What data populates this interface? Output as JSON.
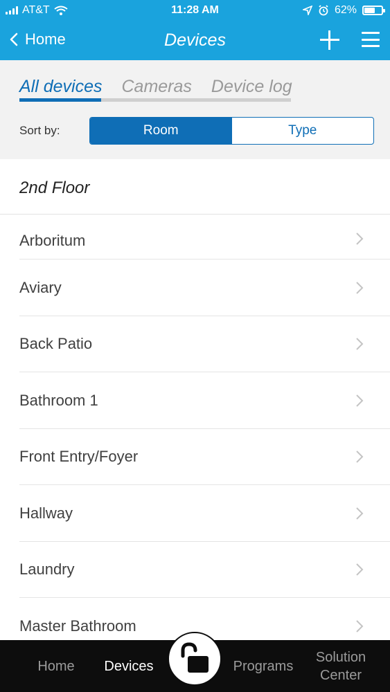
{
  "status": {
    "carrier": "AT&T",
    "time": "11:28 AM",
    "battery": "62%",
    "battery_level": 0.62
  },
  "nav": {
    "back_label": "Home",
    "title": "Devices"
  },
  "tabs": [
    {
      "label": "All devices",
      "active": true
    },
    {
      "label": "Cameras",
      "active": false
    },
    {
      "label": "Device log",
      "active": false
    }
  ],
  "sort": {
    "label": "Sort by:",
    "options": [
      "Room",
      "Type"
    ],
    "selected": "Room"
  },
  "section": {
    "title": "2nd Floor"
  },
  "rooms": [
    "Arboritum",
    "Aviary",
    "Back Patio",
    "Bathroom 1",
    "Front Entry/Foyer",
    "Hallway",
    "Laundry",
    "Master Bathroom"
  ],
  "tabbar": {
    "home": "Home",
    "devices": "Devices",
    "programs": "Programs",
    "solution_line1": "Solution",
    "solution_line2": "Center"
  },
  "colors": {
    "header": "#1aa3dd",
    "accent": "#0f6eb6",
    "tabbar": "#0d0d0d"
  },
  "icons": [
    "signal-icon",
    "wifi-icon",
    "location-icon",
    "alarm-icon",
    "battery-icon",
    "back-chevron-icon",
    "plus-icon",
    "hamburger-menu-icon",
    "chevron-right-icon",
    "unlocked-padlock-icon"
  ]
}
